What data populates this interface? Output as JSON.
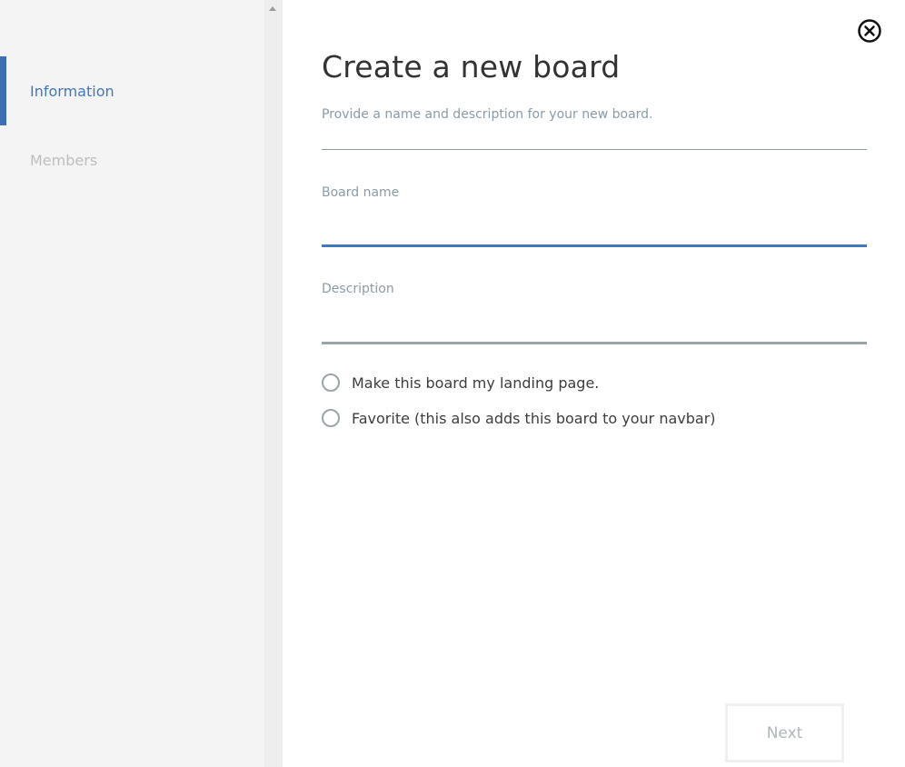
{
  "sidebar": {
    "items": [
      {
        "label": "Information",
        "active": true
      },
      {
        "label": "Members",
        "active": false
      }
    ]
  },
  "dialog": {
    "title": "Create a new board",
    "subtitle": "Provide a name and description for your new board.",
    "fields": {
      "board_name": {
        "label": "Board name",
        "value": "",
        "placeholder": ""
      },
      "description": {
        "label": "Description",
        "value": "",
        "placeholder": ""
      }
    },
    "options": [
      {
        "label": "Make this board my landing page.",
        "checked": false
      },
      {
        "label": "Favorite (this also adds this board to your navbar)",
        "checked": false
      }
    ],
    "next_label": "Next",
    "close_icon": "close-circle-icon"
  },
  "colors": {
    "accent": "#4178be",
    "sidebar_bg": "#f4f4f4",
    "muted_text": "#8c9ba5",
    "inactive_nav": "#bebebe",
    "disabled_button_text": "#b0b7ba"
  }
}
